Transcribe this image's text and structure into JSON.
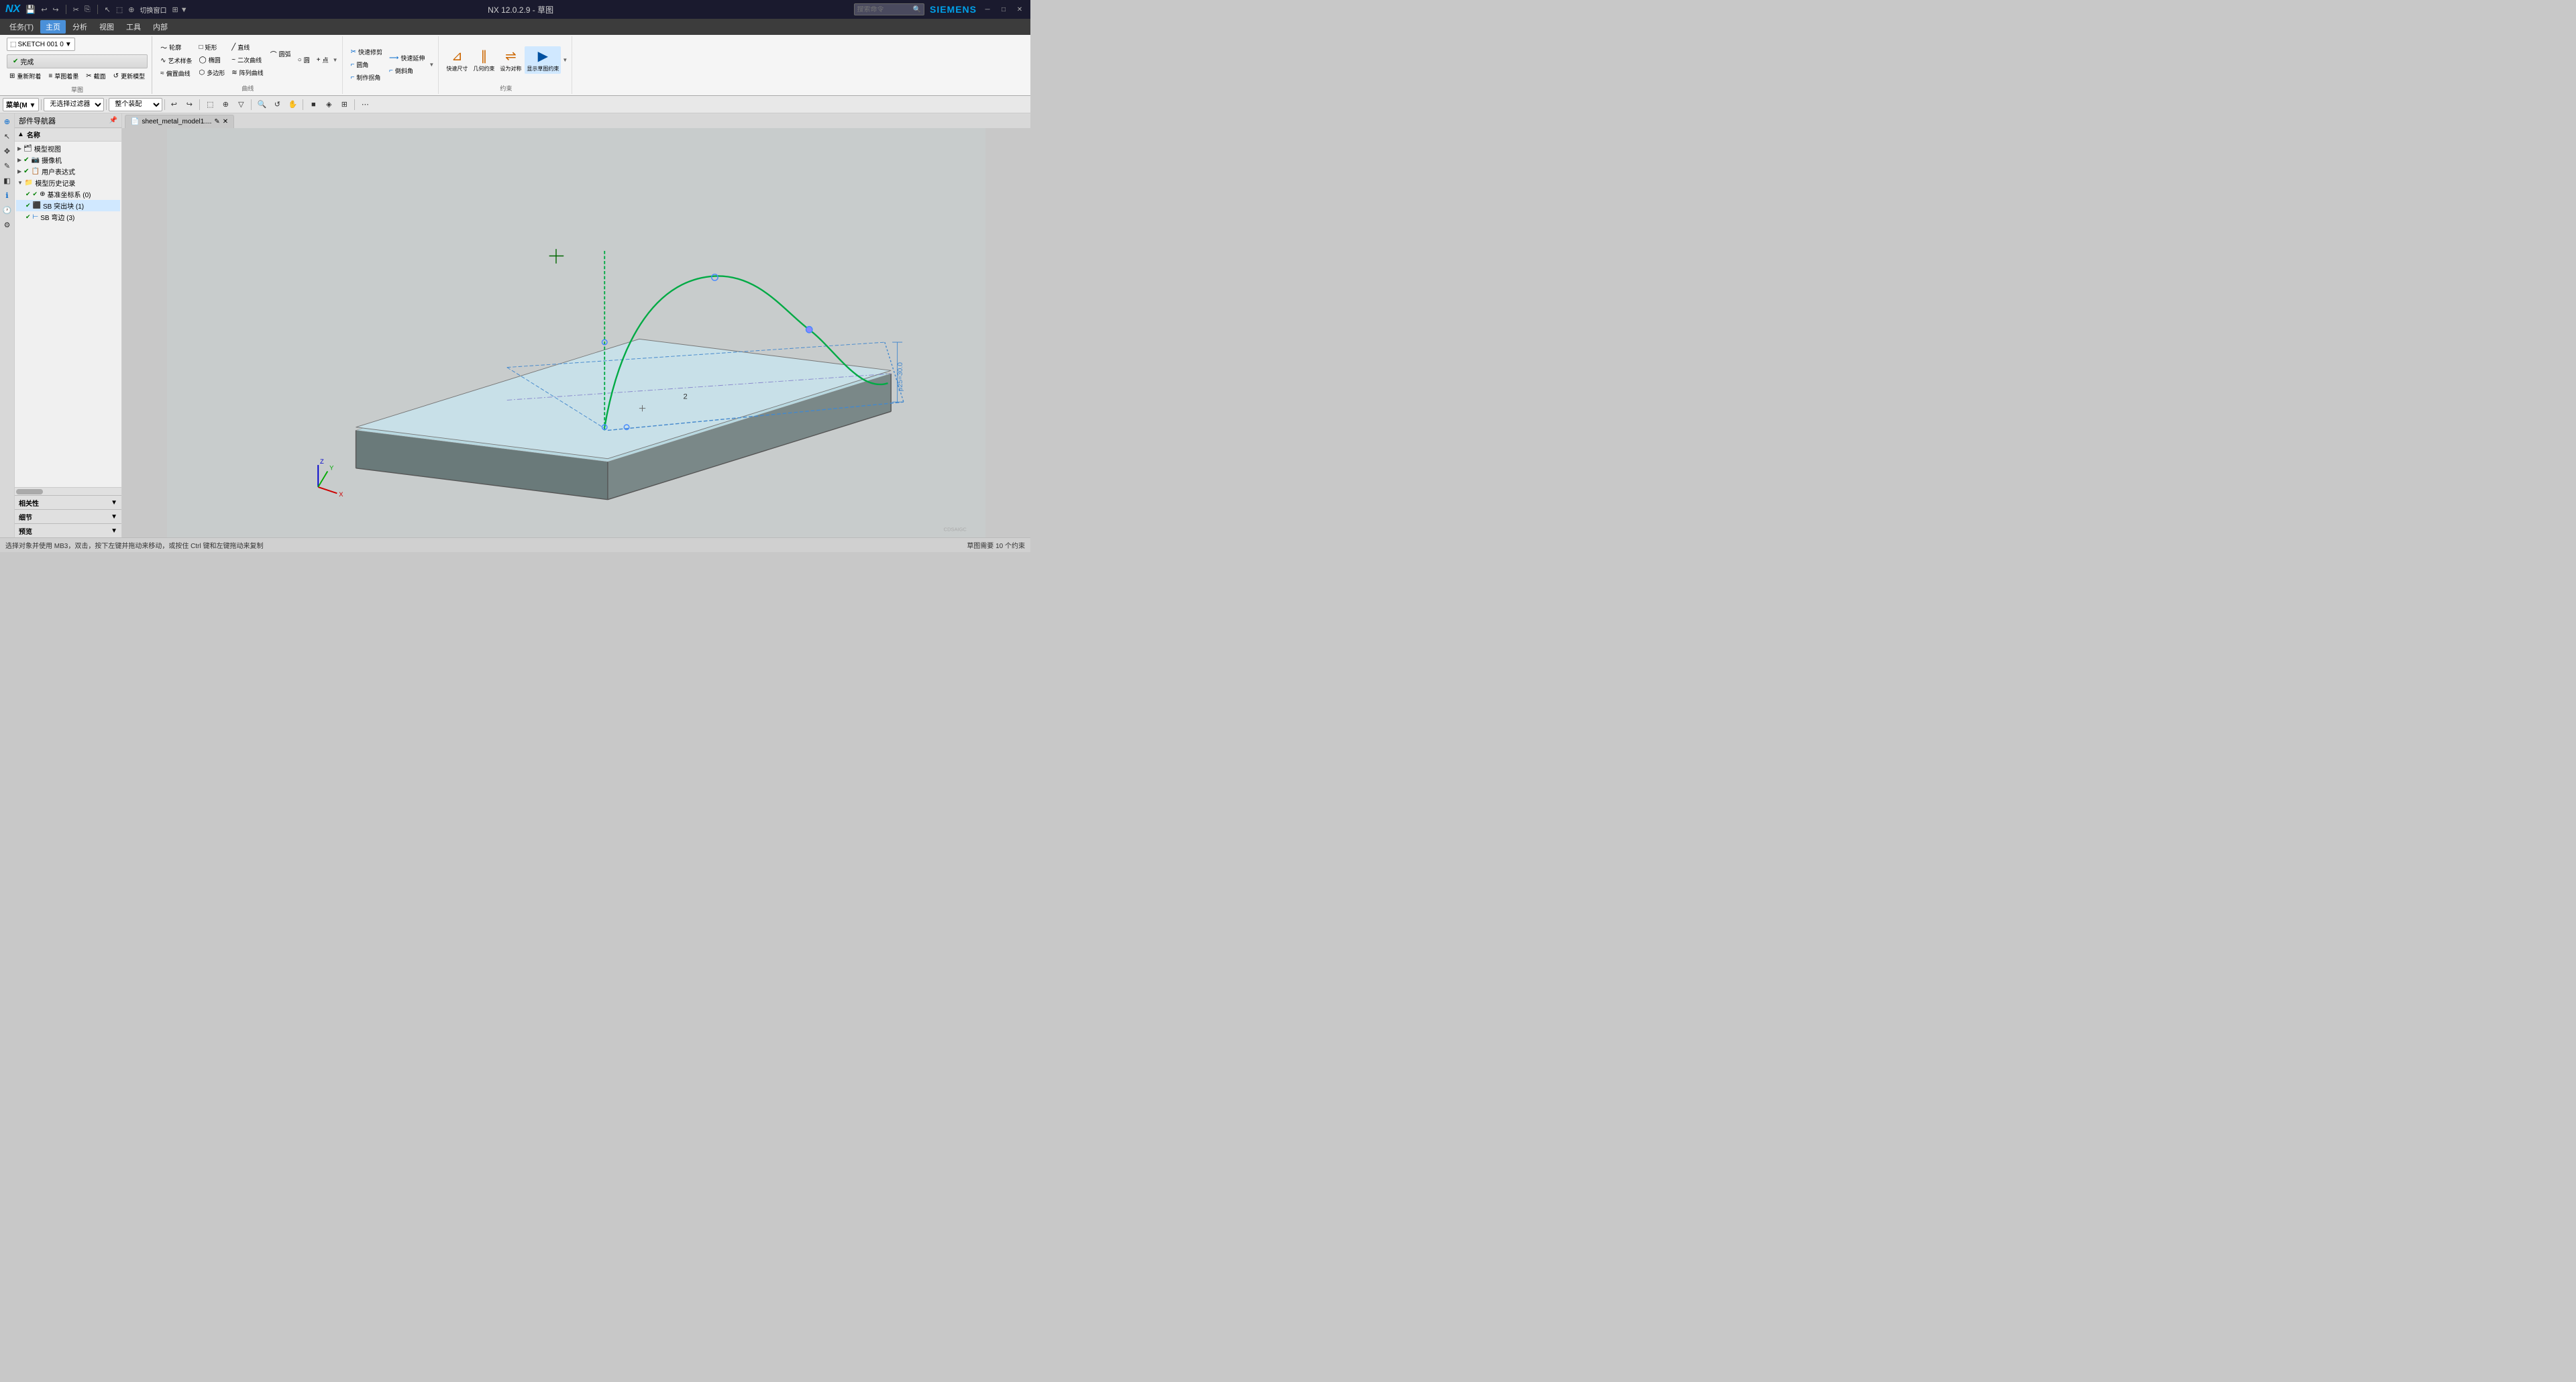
{
  "titleBar": {
    "appName": "NX",
    "title": "NX 12.0.2.9 - 草图",
    "siemens": "SIEMENS",
    "windowControls": [
      "─",
      "□",
      "✕"
    ]
  },
  "menuBar": {
    "items": [
      "任务(T)",
      "主页",
      "分析",
      "视图",
      "工具",
      "内部"
    ]
  },
  "ribbonTabs": {
    "active": "主页",
    "tabs": [
      "任务(T)",
      "主页",
      "分析",
      "视图",
      "工具",
      "内部"
    ]
  },
  "ribbonGroups": {
    "sketch": {
      "label": "草图",
      "dropdown": "SKETCH 001 0",
      "buttons": [
        {
          "icon": "⊞",
          "label": "重新附着"
        },
        {
          "icon": "≡",
          "label": "草图着墨"
        },
        {
          "icon": "✂",
          "label": "截面"
        },
        {
          "icon": "↺",
          "label": "更新模型"
        }
      ]
    },
    "curve": {
      "label": "曲线",
      "buttons": [
        {
          "icon": "〜",
          "label": "轮廓"
        },
        {
          "icon": "□",
          "label": "矩形"
        },
        {
          "icon": "╱",
          "label": "直线"
        },
        {
          "icon": "⌒",
          "label": "圆弧"
        },
        {
          "icon": "○",
          "label": "圆"
        },
        {
          "icon": "+",
          "label": "点"
        },
        {
          "icon": "∿",
          "label": "艺术样条"
        },
        {
          "icon": "◯",
          "label": "椭圆"
        },
        {
          "icon": "≈",
          "label": "偏置曲线"
        },
        {
          "icon": "⬡",
          "label": "多边形"
        },
        {
          "icon": "~",
          "label": "二次曲线"
        },
        {
          "icon": "≋",
          "label": "阵列曲线"
        }
      ]
    },
    "edit": {
      "label": "",
      "buttons": [
        {
          "icon": "✂",
          "label": "快速修剪"
        },
        {
          "icon": "⟶",
          "label": "快速延伸"
        },
        {
          "icon": "⌐",
          "label": "圆角"
        },
        {
          "icon": "⌐",
          "label": "倒斜角"
        },
        {
          "icon": "⌐",
          "label": "制作拐角"
        }
      ]
    },
    "constraint": {
      "label": "约束",
      "buttons": [
        {
          "icon": "⊿",
          "label": "快速尺寸"
        },
        {
          "icon": "⊿",
          "label": "几何约束"
        },
        {
          "icon": "⊿",
          "label": "设为对称"
        },
        {
          "icon": "▶",
          "label": "显示草图约束"
        }
      ]
    }
  },
  "toolbar": {
    "menuLabel": "菜单(M)",
    "filterLabel": "无选择过滤器",
    "assemblyLabel": "整个装配"
  },
  "partNavigator": {
    "title": "部件导航器",
    "columnHeader": "名称",
    "tree": [
      {
        "level": 0,
        "expanded": true,
        "checked": true,
        "label": "模型视图",
        "icon": "model"
      },
      {
        "level": 0,
        "expanded": true,
        "checked": true,
        "label": "摄像机",
        "icon": "camera"
      },
      {
        "level": 0,
        "expanded": true,
        "checked": true,
        "label": "用户表达式",
        "icon": "expr"
      },
      {
        "level": 0,
        "expanded": true,
        "checked": true,
        "label": "模型历史记录",
        "icon": "history"
      },
      {
        "level": 1,
        "expanded": false,
        "checked": true,
        "label": "基准坐标系 (0)",
        "icon": "coord"
      },
      {
        "level": 1,
        "expanded": false,
        "checked": true,
        "label": "SB 突出块 (1)",
        "icon": "block"
      },
      {
        "level": 1,
        "expanded": false,
        "checked": true,
        "label": "SB 弯边 (3)",
        "icon": "bend"
      }
    ],
    "panels": [
      {
        "label": "相关性",
        "expanded": false
      },
      {
        "label": "细节",
        "expanded": false
      },
      {
        "label": "预览",
        "expanded": false
      }
    ]
  },
  "documentTab": {
    "name": "sheet_metal_model1....",
    "icon": "📄"
  },
  "statusBar": {
    "leftText": "选择对象并使用 MB3，双击，按下左键并拖动来移动，或按住 Ctrl 键和左键拖动来复制",
    "rightText": "草图需要 10 个约束"
  },
  "canvas": {
    "backgroundColor": "#c0cccc",
    "modelColor": "#b0cccc"
  },
  "searchBox": {
    "placeholder": "搜索命令"
  }
}
